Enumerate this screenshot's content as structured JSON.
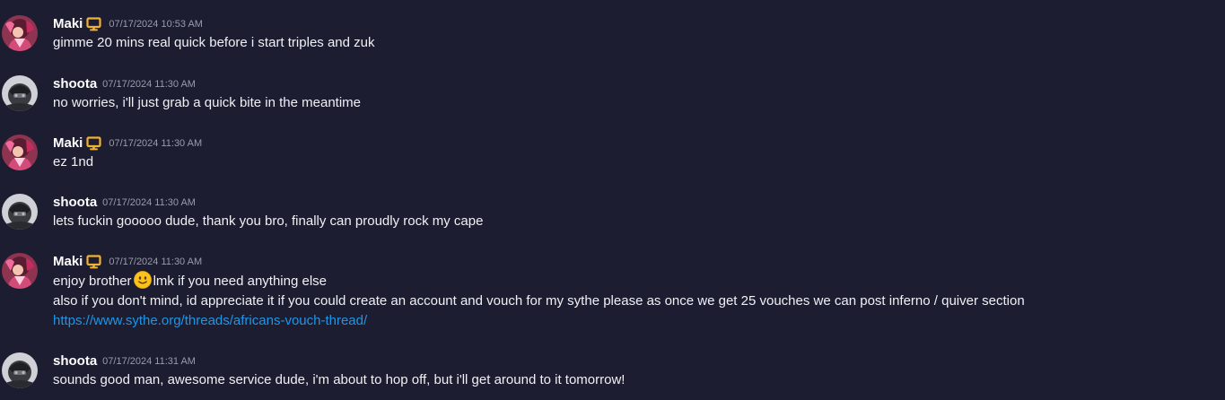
{
  "messages": [
    {
      "author": "Maki",
      "has_badge": true,
      "badge_icon": "desktop-icon",
      "timestamp": "07/17/2024 10:53 AM",
      "lines": [
        "gimme 20 mins real quick before i start triples and zuk"
      ]
    },
    {
      "author": "shoota",
      "has_badge": false,
      "timestamp": "07/17/2024 11:30 AM",
      "lines": [
        "no worries, i'll just grab a quick bite in the meantime"
      ]
    },
    {
      "author": "Maki",
      "has_badge": true,
      "badge_icon": "desktop-icon",
      "timestamp": "07/17/2024 11:30 AM",
      "lines": [
        "ez 1nd"
      ]
    },
    {
      "author": "shoota",
      "has_badge": false,
      "timestamp": "07/17/2024 11:30 AM",
      "lines": [
        "lets fuckin gooooo dude, thank you bro, finally can proudly rock my cape"
      ]
    },
    {
      "author": "Maki",
      "has_badge": true,
      "badge_icon": "desktop-icon",
      "timestamp": "07/17/2024 11:30 AM",
      "line1_before_emoji": "enjoy brother",
      "emoji": "slightly-smiling-face-emoji",
      "line1_after_emoji": "lmk if you need anything else",
      "line2": "also if you don't mind, id appreciate it if you could create an account and vouch for my sythe please as once we get 25 vouches we can post inferno / quiver section",
      "link": "https://www.sythe.org/threads/africans-vouch-thread/"
    },
    {
      "author": "shoota",
      "has_badge": false,
      "timestamp": "07/17/2024 11:31 AM",
      "lines": [
        "sounds good man, awesome service dude, i'm about to hop off, but i'll get around to it tomorrow!"
      ]
    }
  ],
  "colors": {
    "background": "#1c1d31",
    "username": "#ffffff",
    "timestamp": "#9a9cab",
    "text": "#f0f0f4",
    "link": "#1e96e8",
    "badge": "#f0b232"
  }
}
